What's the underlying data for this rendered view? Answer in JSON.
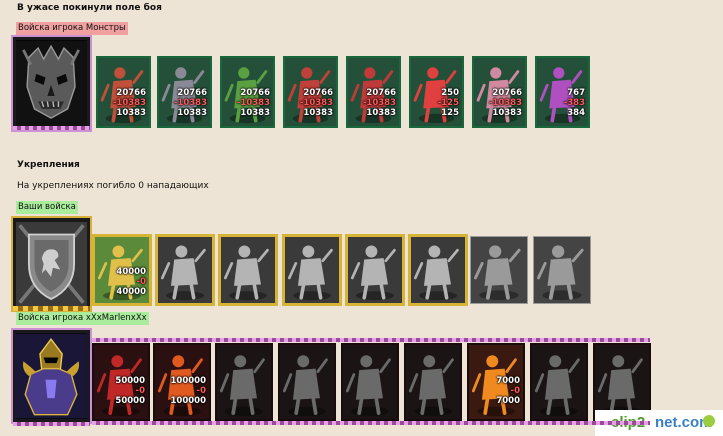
{
  "headings": {
    "fled": "В ужасе покинули поле боя",
    "fortifications": "Укрепления",
    "fort_text": "На укреплениях погибло 0 нападающих"
  },
  "tags": {
    "monsters": "Войска игрока Монстры",
    "yours": "Ваши войска",
    "player": "Войска игрока xXxMarlenxXx"
  },
  "monster_units": [
    {
      "icon": "hydra-icon",
      "n1": "20766",
      "n2": "-10383",
      "n3": "10383"
    },
    {
      "icon": "golem-icon",
      "n1": "20766",
      "n2": "-10383",
      "n3": "10383"
    },
    {
      "icon": "orc-icon",
      "n1": "20766",
      "n2": "-10383",
      "n3": "10383"
    },
    {
      "icon": "gargoyle-icon",
      "n1": "20766",
      "n2": "-10383",
      "n3": "10383"
    },
    {
      "icon": "pit-lord-icon",
      "n1": "20766",
      "n2": "-10383",
      "n3": "10383"
    },
    {
      "icon": "demon-icon",
      "n1": "250",
      "n2": "-125",
      "n3": "125"
    },
    {
      "icon": "castle-icon",
      "n1": "20766",
      "n2": "-10383",
      "n3": "10383"
    },
    {
      "icon": "archdemon-icon",
      "n1": "767",
      "n2": "-383",
      "n3": "384"
    }
  ],
  "your_units": [
    {
      "icon": "king-icon",
      "n1": "40000",
      "n2": "-0",
      "n3": "40000"
    },
    {
      "icon": "crossbowman-icon"
    },
    {
      "icon": "knight-icon"
    },
    {
      "icon": "griffin-icon"
    },
    {
      "icon": "archer-icon"
    },
    {
      "icon": "monk-icon"
    },
    {
      "icon": "paladin-icon"
    },
    {
      "icon": "angel-icon"
    }
  ],
  "player_units": [
    {
      "icon": "imp-icon",
      "n1": "50000",
      "n2": "-0",
      "n3": "50000"
    },
    {
      "icon": "fire-demon-icon",
      "n1": "100000",
      "n2": "-0",
      "n3": "100000"
    },
    {
      "icon": "hellhound-icon"
    },
    {
      "icon": "succubus-icon"
    },
    {
      "icon": "nightmare-icon"
    },
    {
      "icon": "pit-fiend-icon"
    },
    {
      "icon": "devil-icon",
      "n1": "7000",
      "n2": "-0",
      "n3": "7000"
    },
    {
      "icon": "horned-demon-icon"
    },
    {
      "icon": "archdevil-icon"
    }
  ],
  "watermark": {
    "clip": "clip2",
    "net": "net.com"
  }
}
